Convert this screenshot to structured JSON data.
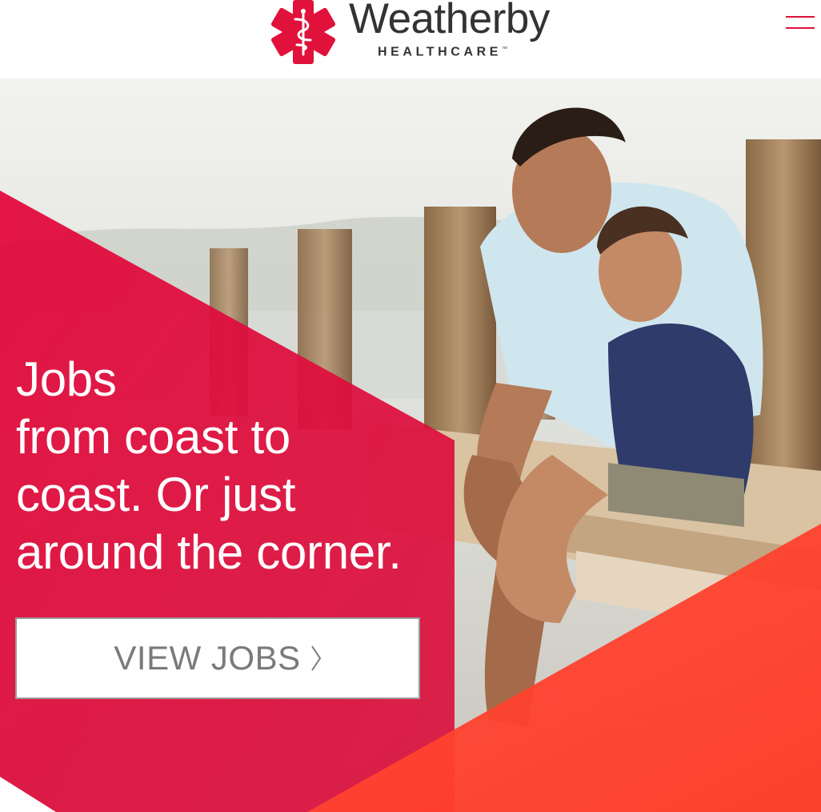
{
  "header": {
    "brand_name": "Weatherby",
    "brand_sub": "HEALTHCARE",
    "trademark": "™",
    "logo_icon": "caduceus-star-icon",
    "menu_icon": "hamburger-menu-icon"
  },
  "hero": {
    "headline_lines": [
      "Jobs",
      "from coast to",
      "coast. Or just",
      "around the corner."
    ],
    "cta_label": "VIEW JOBS",
    "cta_icon": "chevron-right-icon",
    "photo": "father-and-son-on-dock-photo"
  },
  "colors": {
    "brand_red": "#e0113b",
    "accent_orange_red": "#ff3b2c",
    "text_dark": "#333333",
    "cta_text": "#7a7a7a"
  }
}
